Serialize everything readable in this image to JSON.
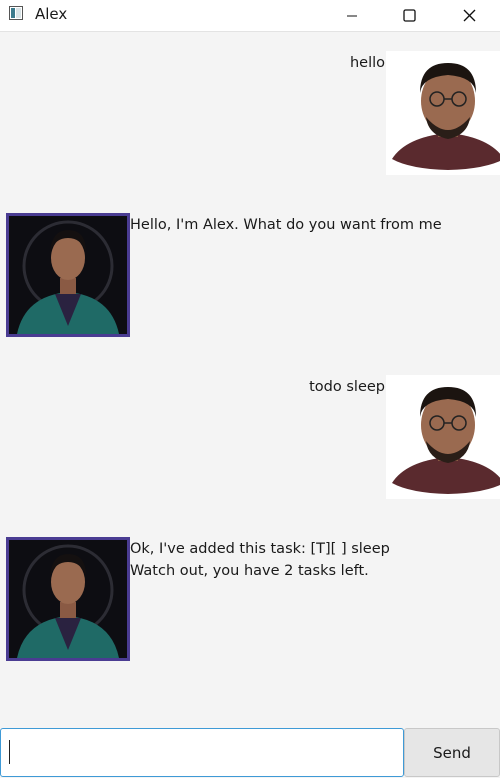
{
  "window": {
    "title": "Alex",
    "app_icon": "window-icon"
  },
  "dialog": [
    {
      "sender": "user",
      "text": "hello",
      "avatar": "user-photo"
    },
    {
      "sender": "bot",
      "text": "Hello, I'm Alex. What do you want from me",
      "avatar": "bot-photo"
    },
    {
      "sender": "user",
      "text": "todo sleep",
      "avatar": "user-photo"
    },
    {
      "sender": "bot",
      "text": "Ok, I've added this task: [T][ ] sleep\nWatch out, you have 2 tasks left.",
      "avatar": "bot-photo"
    }
  ],
  "input": {
    "value": "",
    "placeholder": ""
  },
  "send_button": {
    "label": "Send"
  },
  "colors": {
    "bot_avatar_border": "#4a3c92",
    "input_focus_border": "#3f9ad6",
    "background": "#f4f4f4"
  }
}
